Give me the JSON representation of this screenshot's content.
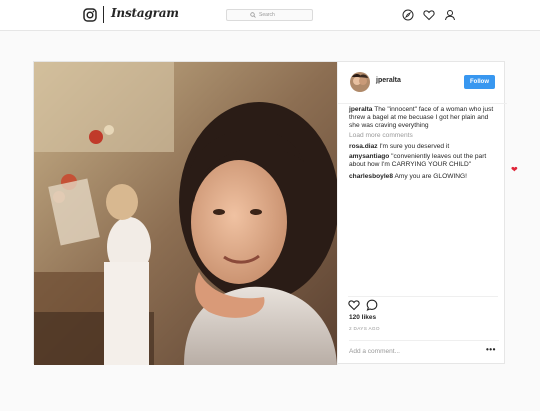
{
  "topbar": {
    "logo_icon": "instagram-camera-icon",
    "wordmark": "Instagram",
    "search_placeholder": "Search",
    "nav_icons": [
      "compass-icon",
      "heart-outline-icon",
      "person-icon"
    ]
  },
  "post": {
    "username": "jperalta",
    "follow_label": "Follow",
    "caption_user": "jperalta",
    "caption_text": "The \"innocent\" face of a woman who just threw a bagel at me becuase I got her plain and she was craving everything",
    "load_more": "Load more comments",
    "comments": [
      {
        "user": "rosa.diaz",
        "text": "I'm sure you deserved it"
      },
      {
        "user": "amysantiago",
        "text": "\"conveniently leaves out the part about how I'm CARRYING YOUR CHILD\""
      },
      {
        "user": "charlesboyle8",
        "text": "Amy you are GLOWING!"
      }
    ],
    "likes": "120 likes",
    "time": "2 DAYS AGO",
    "add_comment_placeholder": "Add a comment...",
    "more_label": "•••"
  },
  "colors": {
    "accent": "#3897f0",
    "heart_red": "#e0263a",
    "muted": "#999999"
  }
}
